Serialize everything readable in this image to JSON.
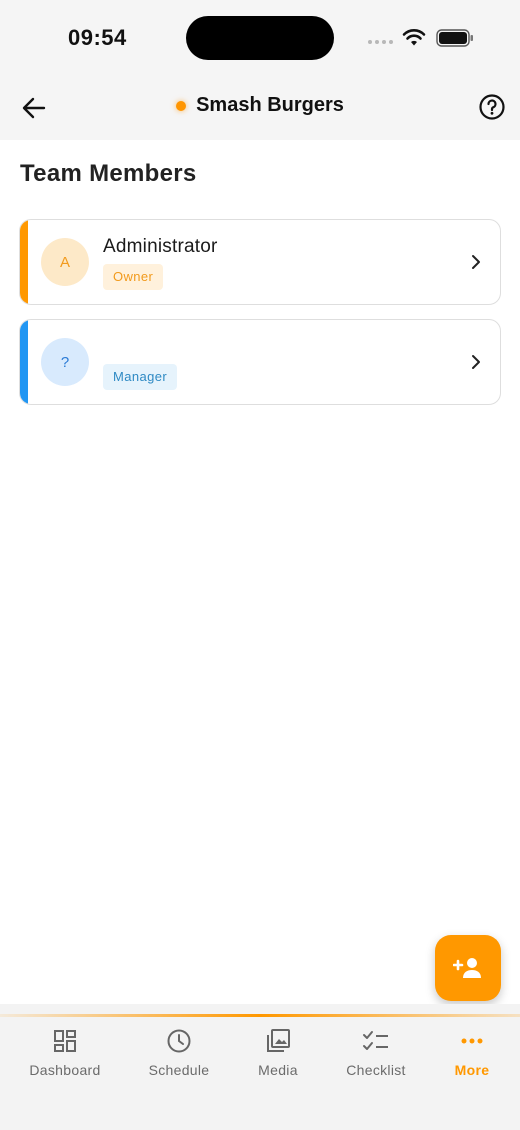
{
  "status_bar": {
    "time": "09:54"
  },
  "header": {
    "title": "Smash Burgers"
  },
  "page": {
    "title": "Team Members"
  },
  "members": [
    {
      "initial": "A",
      "name": "Administrator",
      "role": "Owner",
      "accent": "#ff9800"
    },
    {
      "initial": "?",
      "name": "",
      "role": "Manager",
      "accent": "#2196f3"
    }
  ],
  "bottom_nav": {
    "items": [
      {
        "label": "Dashboard",
        "icon": "dashboard-icon"
      },
      {
        "label": "Schedule",
        "icon": "clock-icon"
      },
      {
        "label": "Media",
        "icon": "media-icon"
      },
      {
        "label": "Checklist",
        "icon": "checklist-icon"
      },
      {
        "label": "More",
        "icon": "more-icon"
      }
    ],
    "active": "More"
  },
  "colors": {
    "accent": "#ff9800",
    "manager": "#2196f3"
  }
}
